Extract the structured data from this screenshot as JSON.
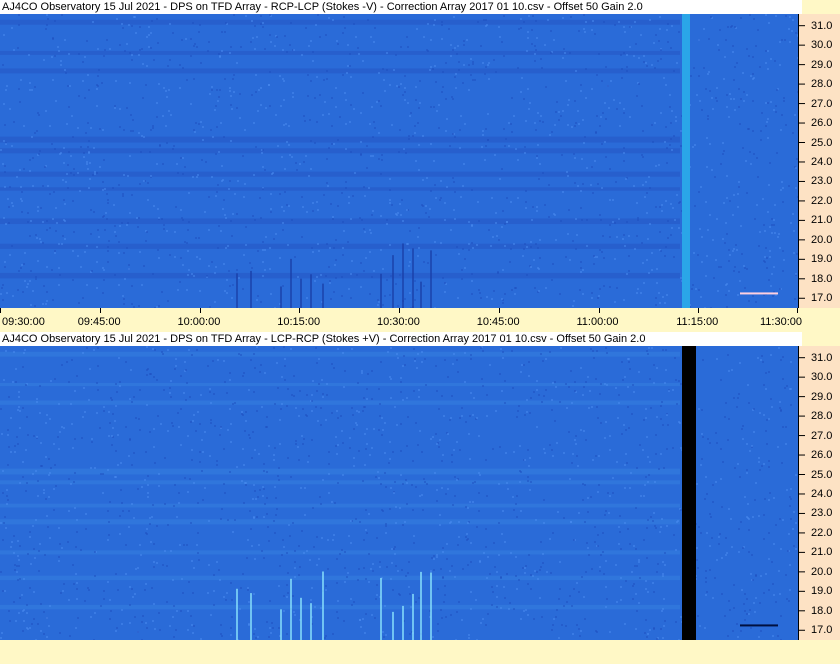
{
  "chart_data": [
    {
      "type": "heatmap",
      "title": "AJ4CO Observatory 15 Jul 2021  -  DPS on TFD Array  -  RCP-LCP (Stokes -V)  -  Correction Array 2017 01 10.csv  -  Offset 50  Gain 2.0",
      "x_ticks": [
        "09:30:00",
        "09:45:00",
        "10:00:00",
        "10:15:00",
        "10:30:00",
        "10:45:00",
        "11:00:00",
        "11:15:00",
        "11:30:00"
      ],
      "y_ticks": [
        "31.0",
        "30.0",
        "29.0",
        "28.0",
        "27.0",
        "26.0",
        "25.0",
        "24.0",
        "23.0",
        "22.0",
        "21.0",
        "20.0",
        "19.0",
        "18.0",
        "17.0"
      ],
      "ylim": [
        16.5,
        31.6
      ],
      "colors": {
        "background": "#2a6bd8",
        "band": "#2455c4",
        "streak": "#4fd0e8",
        "gap": "#2aa6e8"
      }
    },
    {
      "type": "heatmap",
      "title": "AJ4CO Observatory 15 Jul 2021  -  DPS on TFD Array  -  LCP-RCP (Stokes +V)  -  Correction Array 2017 01 10.csv  -  Offset 50  Gain 2.0",
      "x_ticks": [],
      "y_ticks": [
        "31.0",
        "30.0",
        "29.0",
        "28.0",
        "27.0",
        "26.0",
        "25.0",
        "24.0",
        "23.0",
        "22.0",
        "21.0",
        "20.0",
        "19.0",
        "18.0",
        "17.0"
      ],
      "ylim": [
        16.5,
        31.6
      ],
      "colors": {
        "background": "#2a6bd8",
        "band": "#3580e0",
        "streak": "#8fe8ff",
        "gap": "#000000"
      }
    }
  ]
}
